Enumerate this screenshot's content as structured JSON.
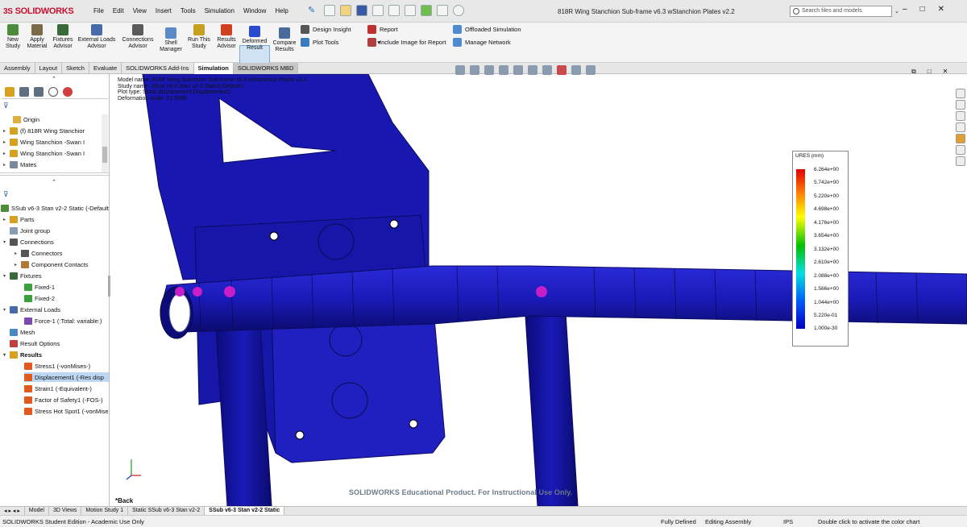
{
  "app": {
    "brand": "SOLIDWORKS",
    "doc_title": "818R Wing Stanchion Sub-frame v6.3 wStanchion Plates v2.2"
  },
  "menu": [
    "File",
    "Edit",
    "View",
    "Insert",
    "Tools",
    "Simulation",
    "Window",
    "Help"
  ],
  "search": {
    "placeholder": "Search files and models"
  },
  "ribbon": {
    "new_study": "New\nStudy",
    "apply_material": "Apply\nMaterial",
    "fixtures_advisor": "Fixtures\nAdvisor",
    "external_loads_advisor": "External Loads\nAdvisor",
    "connections_advisor": "Connections\nAdvisor",
    "shell_manager": "Shell\nManager",
    "run_this_study": "Run This\nStudy",
    "results_advisor": "Results\nAdvisor",
    "deformed_result": "Deformed\nResult",
    "compare_results": "Compare\nResults",
    "design_insight": "Design Insight",
    "plot_tools": "Plot Tools",
    "report": "Report",
    "include_image": "Include Image for Report",
    "offloaded_simulation": "Offloaded Simulation",
    "manage_network": "Manage Network"
  },
  "tabs": [
    "Assembly",
    "Layout",
    "Sketch",
    "Evaluate",
    "SOLIDWORKS Add-Ins",
    "Simulation",
    "SOLIDWORKS MBD"
  ],
  "active_tab": "Simulation",
  "tree_top": [
    {
      "label": "Origin"
    },
    {
      "label": "(f) 818R Wing Stanchior"
    },
    {
      "label": "Wing Stanchion -Swan I"
    },
    {
      "label": "Wing Stanchion -Swan I"
    },
    {
      "label": "Mates"
    }
  ],
  "study_tree": [
    {
      "label": "SSub v6-3 Stan v2-2 Static (-Default"
    },
    {
      "label": "Parts"
    },
    {
      "label": "Joint group"
    },
    {
      "label": "Connections"
    },
    {
      "label": "Connectors"
    },
    {
      "label": "Component Contacts"
    },
    {
      "label": "Fixtures"
    },
    {
      "label": "Fixed-1"
    },
    {
      "label": "Fixed-2"
    },
    {
      "label": "External Loads"
    },
    {
      "label": "Force-1 (:Total: variable:)"
    },
    {
      "label": "Mesh"
    },
    {
      "label": "Result Options"
    },
    {
      "label": "Results"
    },
    {
      "label": "Stress1 (-vonMises-)"
    },
    {
      "label": "Displacement1 (-Res disp"
    },
    {
      "label": "Strain1 (-Equivalent-)"
    },
    {
      "label": "Factor of Safety1 (-FOS-)"
    },
    {
      "label": "Stress Hot Spot1 (-vonMise"
    }
  ],
  "viewport": {
    "info": [
      "Model name: 818R Wing Stanchion Sub-frame v6.3 wStanchion Plates v2.2",
      "Study name: SSub v6-3 Stan v2-2 Static(-Default-)",
      "Plot type: Static displacement Displacement1",
      "Deformation scale: 21.5598"
    ],
    "back": "*Back",
    "watermark": "SOLIDWORKS Educational Product. For Instructional Use Only."
  },
  "legend": {
    "title": "URES (mm)",
    "ticks": [
      "6.264e+00",
      "5.742e+00",
      "5.220e+00",
      "4.698e+00",
      "4.176e+00",
      "3.654e+00",
      "3.132e+00",
      "2.610e+00",
      "2.088e+00",
      "1.566e+00",
      "1.044e+00",
      "5.220e-01",
      "1.000e-30"
    ]
  },
  "colors": {
    "part": "#1a1ab8",
    "part_dark": "#0b0b6e",
    "marker": "#c81ec8"
  },
  "bottom_tabs": [
    "Model",
    "3D Views",
    "Motion Study 1",
    "Static SSub v6-3 Stan v2-2",
    "SSub v6-3 Stan v2-2 Static"
  ],
  "status": {
    "left": "SOLIDWORKS Student Edition - Academic Use Only",
    "mode": "Fully Defined",
    "editing": "Editing Assembly",
    "units": "IPS",
    "hint": "Double click to activate the color chart"
  }
}
